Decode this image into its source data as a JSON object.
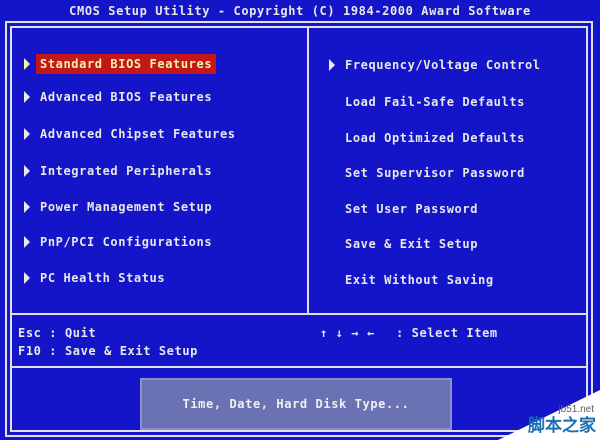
{
  "window": {
    "title": "CMOS Setup Utility - Copyright (C) 1984-2000 Award Software"
  },
  "menu": {
    "left": [
      {
        "label": "Standard BIOS Features",
        "selected": true
      },
      {
        "label": "Advanced BIOS Features",
        "selected": false
      },
      {
        "label": "Advanced Chipset Features",
        "selected": false
      },
      {
        "label": "Integrated Peripherals",
        "selected": false
      },
      {
        "label": "Power Management Setup",
        "selected": false
      },
      {
        "label": "PnP/PCI Configurations",
        "selected": false
      },
      {
        "label": "PC Health Status",
        "selected": false
      }
    ],
    "right": [
      {
        "label": "Frequency/Voltage Control",
        "has_arrow": true
      },
      {
        "label": "Load Fail-Safe Defaults",
        "has_arrow": false
      },
      {
        "label": "Load Optimized Defaults",
        "has_arrow": false
      },
      {
        "label": "Set Supervisor Password",
        "has_arrow": false
      },
      {
        "label": "Set User Password",
        "has_arrow": false
      },
      {
        "label": "Save & Exit Setup",
        "has_arrow": false
      },
      {
        "label": "Exit Without Saving",
        "has_arrow": false
      }
    ]
  },
  "help": {
    "esc": "Esc : Quit",
    "f10": "F10 : Save & Exit Setup",
    "arrows": "↑ ↓ → ←",
    "select": ": Select Item"
  },
  "description": "Time, Date, Hard Disk Type...",
  "watermark": {
    "url": "jb51.net",
    "name": "脚本之家"
  },
  "colors": {
    "background": "#1414c8",
    "highlight": "#c41818",
    "highlight_text": "#f4f4a8",
    "text": "#e8e8e8"
  }
}
